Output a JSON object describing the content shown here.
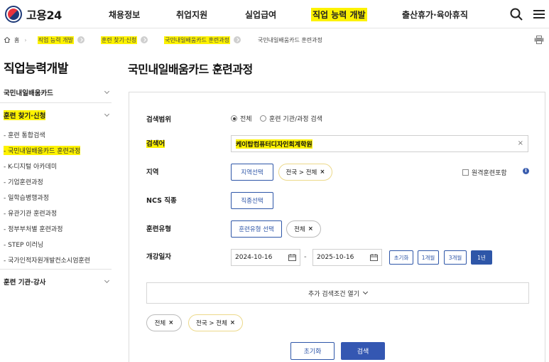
{
  "header": {
    "logo_text": "고용24",
    "nav": [
      "채용정보",
      "취업지원",
      "실업급여",
      "직업 능력 개발",
      "출산휴가·육아휴직"
    ],
    "highlight_color": "#fdf200"
  },
  "breadcrumb": {
    "home": "홈",
    "items": [
      "직업 능력 개발",
      "훈련 찾기·신청",
      "국민내일배움카드 훈련과정",
      "국민내일배움카드 훈련과정"
    ]
  },
  "sidebar": {
    "title": "직업능력개발",
    "sections": [
      "국민내일배움카드",
      "훈련 찾기·신청",
      "훈련 기관·강사"
    ],
    "sub_items": [
      "- 훈련 통합검색",
      "- 국민내일배움카드 훈련과정",
      "- K-디지털 아카데미",
      "- 기업훈련과정",
      "- 일학습병행과정",
      "- 유관기관 훈련과정",
      "- 정부부처별 훈련과정",
      "- STEP 이러닝",
      "- 국가인적자원개발컨소시엄훈련"
    ]
  },
  "main": {
    "title": "국민내일배움카드 훈련과정",
    "labels": {
      "scope": "검색범위",
      "keyword": "검색어",
      "region": "지역",
      "ncs": "NCS 직종",
      "type": "훈련유형",
      "date": "개강일자"
    },
    "scope_options": [
      "전체",
      "훈련 기관/과정 검색"
    ],
    "keyword_value": "케이탑컴퓨터디자인회계학원",
    "region_button": "지역선택",
    "region_chip": "전국 > 전체",
    "remote_checkbox": "원격훈련포함",
    "info_icon": "i",
    "ncs_button": "직종선택",
    "type_button": "훈련유형 선택",
    "type_chip": "전체",
    "date_start": "2024-10-16",
    "date_end": "2025-10-16",
    "date_dash": "-",
    "period_buttons": [
      "초기화",
      "1개월",
      "3개월",
      "1년"
    ],
    "more_label": "추가 검색조건 열기",
    "summary_chips": [
      "전체",
      "전국 > 전체"
    ],
    "reset_label": "초기화",
    "search_label": "검색",
    "chip_close": "×",
    "clear_mark": "×"
  }
}
